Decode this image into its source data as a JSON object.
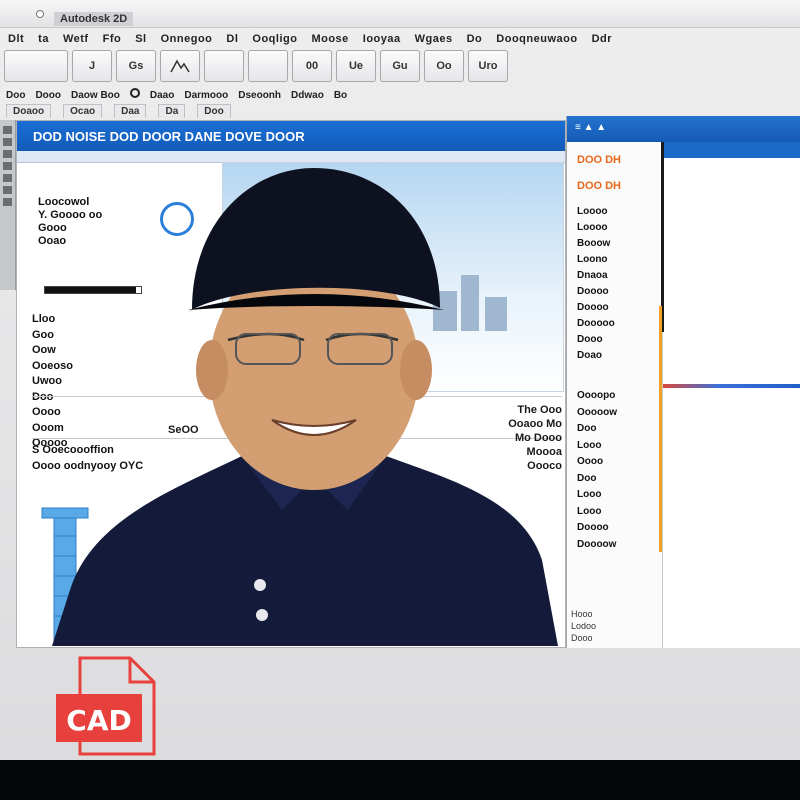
{
  "window": {
    "title": "Autodesk 2D",
    "menu": [
      "Dlt",
      "ta",
      "Wetf",
      "Ffo",
      "Sl",
      "Onnegoo",
      "Dl",
      "Ooqligo",
      "Moose",
      "Iooyaa",
      "Wgaes",
      "Do",
      "Dooqneuwaoo",
      "Ddr"
    ]
  },
  "toolbar": {
    "tools": [
      "",
      "J",
      "Gs",
      "A",
      "",
      "",
      "00",
      "Ue",
      "Gu",
      "Oo",
      "Uro"
    ]
  },
  "breadcrumb": [
    "Doo",
    "Dooo",
    "Daow Boo",
    "Daao",
    "Darmooo",
    "Dseoonh",
    "Ddwao",
    "Bo"
  ],
  "tabs": [
    "Doaoo",
    "Ocao",
    "Daa",
    "Da",
    "Doo"
  ],
  "document": {
    "header_title": "DOD NOISE DOD DOOR DANE DOVE DOOR",
    "fields": [
      "Loocowol",
      "Y. Goooo oo",
      "Gooo",
      "Ooao"
    ],
    "list": [
      "Lloo",
      "Goo",
      "Oow",
      "Ooeoso",
      "Uwoo",
      "Doo",
      "Oooo",
      "Ooom",
      "Ooooo"
    ],
    "summary_line_1": "S Ooecoooffion",
    "summary_line_2": "Oooo oodnyooy OYC",
    "code_left": "SeOO",
    "code_center": "Ooaoo Mo",
    "code_right": "Mo Dooo",
    "table_right_top": "The Ooo",
    "table_right_a": "Moooa",
    "table_right_b": "Oooco",
    "progress_fraction": 0.95
  },
  "right_panel": {
    "tag_1": "DOO DH",
    "tag_2": "DOO DH",
    "items": [
      "Loooo",
      "Loooo",
      "Booow",
      "Loono",
      "Dnaoa",
      "Doooo",
      "Doooo",
      "Dooooo",
      "Dooo",
      "Doao"
    ],
    "items_2": [
      "Oooopo",
      "Ooooow",
      "Doo",
      "Looo",
      "Oooo",
      "Doo",
      "Looo",
      "Looo",
      "Doooo",
      "Doooow"
    ],
    "footer": [
      "Hooo",
      "Lodoo",
      "Dooo"
    ]
  },
  "badge": {
    "text": "CAD",
    "color": "#e8403c"
  },
  "colors": {
    "accent_blue": "#1b6fd6",
    "orange": "#e8671a",
    "shirt": "#141b3a"
  }
}
